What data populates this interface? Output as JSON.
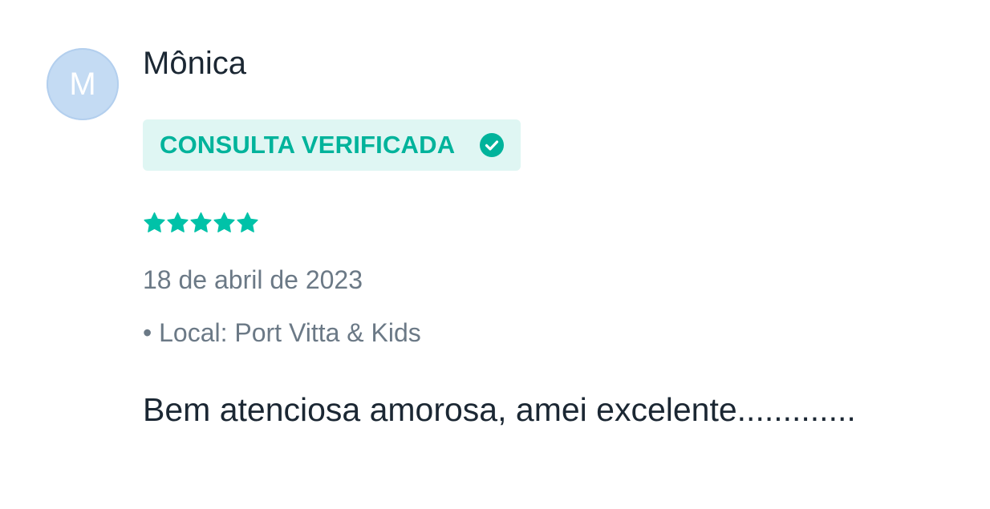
{
  "review": {
    "author": {
      "name": "Mônica",
      "initial": "M",
      "avatar_bg": "#c4dbf3"
    },
    "badge": {
      "label": "CONSULTA VERIFICADA",
      "icon": "check-circle-icon",
      "color": "#00b39b",
      "bg": "#dff6f3"
    },
    "rating": {
      "value": 5,
      "max": 5,
      "star_color": "#00c2a8"
    },
    "date": "18 de abril de 2023",
    "location": "• Local: Port Vitta & Kids",
    "text": "Bem atenciosa amorosa, amei excelente............."
  }
}
